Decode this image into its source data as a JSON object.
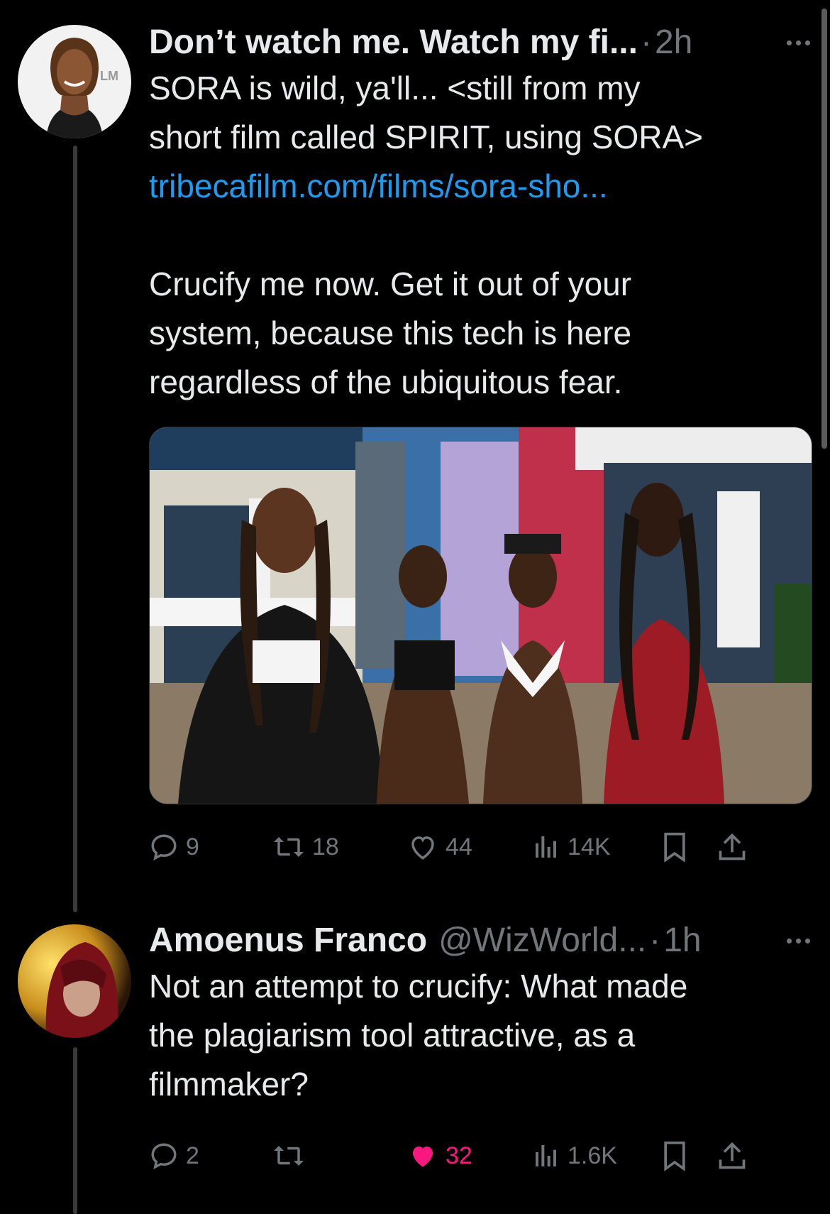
{
  "tweets": [
    {
      "author_name": "Don’t watch me. Watch my fi...",
      "author_handle": "",
      "sep": "·",
      "time": "2h",
      "text_lines": [
        "SORA is wild, ya'll... <still from my",
        "short film called SPIRIT, using SORA>"
      ],
      "link": "tribecafilm.com/films/sora-sho...",
      "text2_lines": [
        "Crucify me now. Get it out of your",
        "system, because this tech is here",
        "regardless of the ubiquitous fear."
      ],
      "avatar_text": "LM",
      "actions": {
        "replies": "9",
        "retweets": "18",
        "likes": "44",
        "views": "14K"
      },
      "liked": false
    },
    {
      "author_name": "Amoenus Franco",
      "author_handle": "@WizWorld...",
      "sep": "·",
      "time": "1h",
      "text_lines": [
        "Not an attempt to crucify: What made",
        "the plagiarism tool attractive, as a",
        "filmmaker?"
      ],
      "actions": {
        "replies": "2",
        "retweets": "",
        "likes": "32",
        "views": "1.6K"
      },
      "liked": true
    }
  ],
  "colors": {
    "background": "#000000",
    "text": "#e7e9ea",
    "muted": "#71767b",
    "link": "#1d9bf0",
    "like": "#f91880"
  }
}
